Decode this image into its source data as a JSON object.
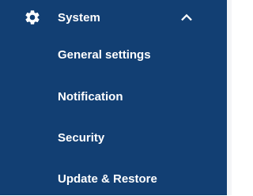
{
  "menu": {
    "header": {
      "icon": "gear-icon",
      "label": "System",
      "chevron": "chevron-up-icon",
      "expanded": true
    },
    "items": [
      {
        "label": "General settings"
      },
      {
        "label": "Notification"
      },
      {
        "label": "Security"
      },
      {
        "label": "Update & Restore"
      }
    ]
  },
  "colors": {
    "background": "#123f73",
    "text": "#ffffff",
    "page": "#f4f5f7"
  }
}
